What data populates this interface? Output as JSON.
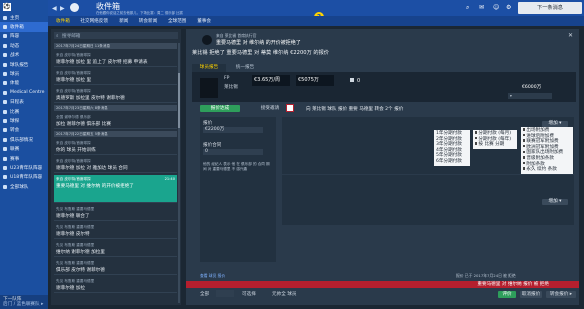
{
  "sidebar": {
    "items": [
      {
        "label": "主页",
        "active": false
      },
      {
        "label": "收件箱",
        "active": true
      },
      {
        "label": "阵容",
        "active": false
      },
      {
        "label": "动态",
        "active": false
      },
      {
        "label": "战术",
        "active": false
      },
      {
        "label": "球队报告",
        "active": false
      },
      {
        "label": "球员",
        "active": false
      },
      {
        "label": "体能",
        "active": false
      },
      {
        "label": "Medical Centre",
        "active": false
      },
      {
        "label": "日程表",
        "active": false
      },
      {
        "label": "比赛",
        "active": false
      },
      {
        "label": "球探",
        "active": false
      },
      {
        "label": "转会",
        "active": false
      },
      {
        "label": "俱乐部情况",
        "active": false
      },
      {
        "label": "联赛",
        "active": false
      },
      {
        "label": "赛事",
        "active": false
      },
      {
        "label": "U23青年队阵容",
        "active": false
      },
      {
        "label": "U18青年队阵容",
        "active": false
      },
      {
        "label": "全部球队",
        "active": false
      }
    ],
    "bottom": {
      "line1": "下一队阵",
      "line2": "后门 / 蓝色联赛队 ▸"
    }
  },
  "topbar": {
    "title": "收件箱",
    "subtitle": "在他跟你说话之前去他那儿，下场比赛：周二 俱乐部 比赛",
    "continue_label": "下一条消息"
  },
  "tabs": [
    "收件箱",
    "社交网络反馈",
    "新闻",
    "转会新闻",
    "全球范围",
    "董事会"
  ],
  "inbox": {
    "search_placeholder": "搜寻邮箱",
    "messages": [
      {
        "sep": "2017年7月24日星期日 11条消息"
      },
      {
        "h": "来自 皮尔特/首席球探",
        "t": "谢菲尔德 加拉 里 追上了 皮尔特 招募 申请表",
        "d": ""
      },
      {
        "h": "来自 皮尔特/首席球探",
        "t": "谢菲尔德 加拉 里",
        "d": ""
      },
      {
        "h": "来自 皮尔特/首席球探",
        "t": "奥德罗斯 加拉里 皮尔特 谢菲尔德",
        "d": ""
      },
      {
        "sep": "2017年7月23日星期六 8条消息"
      },
      {
        "h": "全国 谢菲尔德 俱乐部",
        "t": "加拉 谢菲尔德 俱乐部 比赛",
        "d": ""
      },
      {
        "sep": "2017年7月22日星期五 5条消息"
      },
      {
        "h": "来自 皮尔特/首席球探",
        "t": "你的 球员 开始训练",
        "d": ""
      },
      {
        "h": "来自 皮尔特/首席球探",
        "t": "谢菲尔德 加拉 对 雅加达 球员 合同",
        "d": ""
      },
      {
        "h": "来自 皮尔特/首席球探",
        "t": "重要马德里 对 维尔纳 的开价被拒绝了",
        "d": "21:40",
        "sel": true
      },
      {
        "h": "先见 布鲁斯 重要马德里",
        "t": "谢菲尔德 联合了",
        "d": ""
      },
      {
        "h": "先见 布鲁斯 重要马德里",
        "t": "谢菲尔德 皮尔特",
        "d": ""
      },
      {
        "h": "先见 布鲁斯 重要马德里",
        "t": "维尔纳 谢菲尔德 加拉里",
        "d": ""
      },
      {
        "h": "先见 布鲁斯 重要马德里",
        "t": "俱乐部 皮尔特 谢菲尔德",
        "d": ""
      },
      {
        "h": "先见 布鲁斯 重要马德里",
        "t": "谢菲尔德 加拉",
        "d": ""
      }
    ]
  },
  "detail": {
    "from": "来自 莱比锡 首席执行官",
    "subject": "重要马德里 对 维尔纳 的开价被拒绝了",
    "headline": "莱比锡 拒绝了 重要马德里 对 蒂莫 维尔纳 €2200万 的报价",
    "subtabs": [
      "球员报告",
      "统一报告"
    ],
    "player": {
      "role": "FP",
      "club": "莱比锡",
      "value": "€3.65万/周",
      "contract": "€5075万",
      "rating": "0",
      "fee": "€6000万"
    },
    "actions": {
      "propose": "报价达成",
      "walk": "接受邀请",
      "negotiate": "向 莱比锡 球队 报价 重要 马德里 转会 2个 报价"
    },
    "left_panel": {
      "h1": "报价",
      "v1": "€2200万",
      "h2": "报价合同",
      "v2": "0",
      "note": "他的 经纪人 表示 他 在 俱乐部 的 合同 期间 对 重要马德里 不 感兴趣"
    },
    "menu_small": [
      "1年分期付款",
      "2年分期付款",
      "3年分期付款",
      "4年分期付款",
      "5年分期付款",
      "6年分期付款"
    ],
    "menu_mid": [
      "分期付款 (每月)",
      "分期付款 (每年)",
      "按 比赛 分期"
    ],
    "menu_big": [
      "出场附加费",
      "进球后附加费",
      "联赛冠军附加费",
      "欧洲冠军附加费",
      "国家队出场附加费",
      "晋级附加条款",
      "附加条款",
      "永久 续约 条款"
    ],
    "dropdown_label": "增加",
    "footer_left": "查看 球员 报价",
    "status": "报价 已于 2017年7月24日 被 拒绝",
    "status2": "重要马德里 对 维尔纳 报价 被 拒绝",
    "buttons": {
      "continue": "评价",
      "cancel": "取消报价",
      "retry": "转会报价 ▸"
    }
  },
  "bottombar": {
    "filter": "全部",
    "actions": [
      "可选择",
      "元帅全 球员"
    ]
  }
}
